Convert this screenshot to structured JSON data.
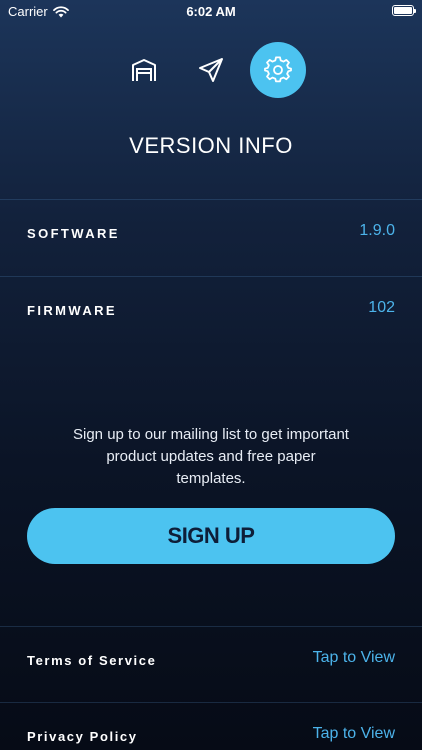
{
  "status_bar": {
    "carrier": "Carrier",
    "time": "6:02 AM"
  },
  "nav": {
    "items": [
      {
        "icon": "home-icon",
        "active": false
      },
      {
        "icon": "send-icon",
        "active": false
      },
      {
        "icon": "gear-icon",
        "active": true
      }
    ]
  },
  "page": {
    "title": "VERSION INFO"
  },
  "info": {
    "software": {
      "label": "SOFTWARE",
      "value": "1.9.0"
    },
    "firmware": {
      "label": "FIRMWARE",
      "value": "102"
    }
  },
  "signup": {
    "text": "Sign up to our mailing list to get important product updates and free paper templates.",
    "button_label": "SIGN UP"
  },
  "links": {
    "terms": {
      "label": "Terms of Service",
      "action": "Tap to View"
    },
    "privacy": {
      "label": "Privacy Policy",
      "action": "Tap to View"
    }
  },
  "colors": {
    "accent": "#4cc3f0",
    "value_text": "#4cb3ea",
    "button_text": "#0e1e38"
  }
}
